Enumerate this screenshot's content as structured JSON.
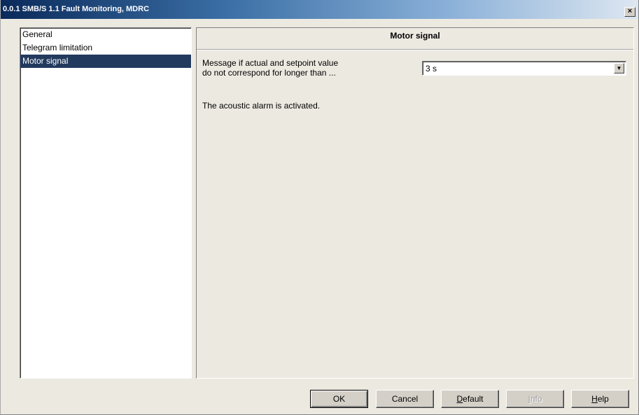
{
  "window": {
    "title": "0.0.1 SMB/S 1.1 Fault Monitoring, MDRC",
    "close_glyph": "×"
  },
  "sidebar": {
    "items": [
      {
        "label": "General",
        "selected": false
      },
      {
        "label": "Telegram limitation",
        "selected": false
      },
      {
        "label": "Motor signal",
        "selected": true
      }
    ]
  },
  "panel": {
    "title": "Motor signal",
    "param_label_line1": "Message if actual and setpoint value",
    "param_label_line2": "do not correspond for longer than ...",
    "select_value": "3 s",
    "info_text": "The acoustic alarm is activated."
  },
  "buttons": {
    "ok": "OK",
    "cancel": "Cancel",
    "default_first": "D",
    "default_rest": "efault",
    "info_first": "I",
    "info_rest": "nfo",
    "help_first": "H",
    "help_rest": "elp"
  },
  "colors": {
    "selected_bg": "#223a5e",
    "window_bg": "#ece9e1"
  }
}
